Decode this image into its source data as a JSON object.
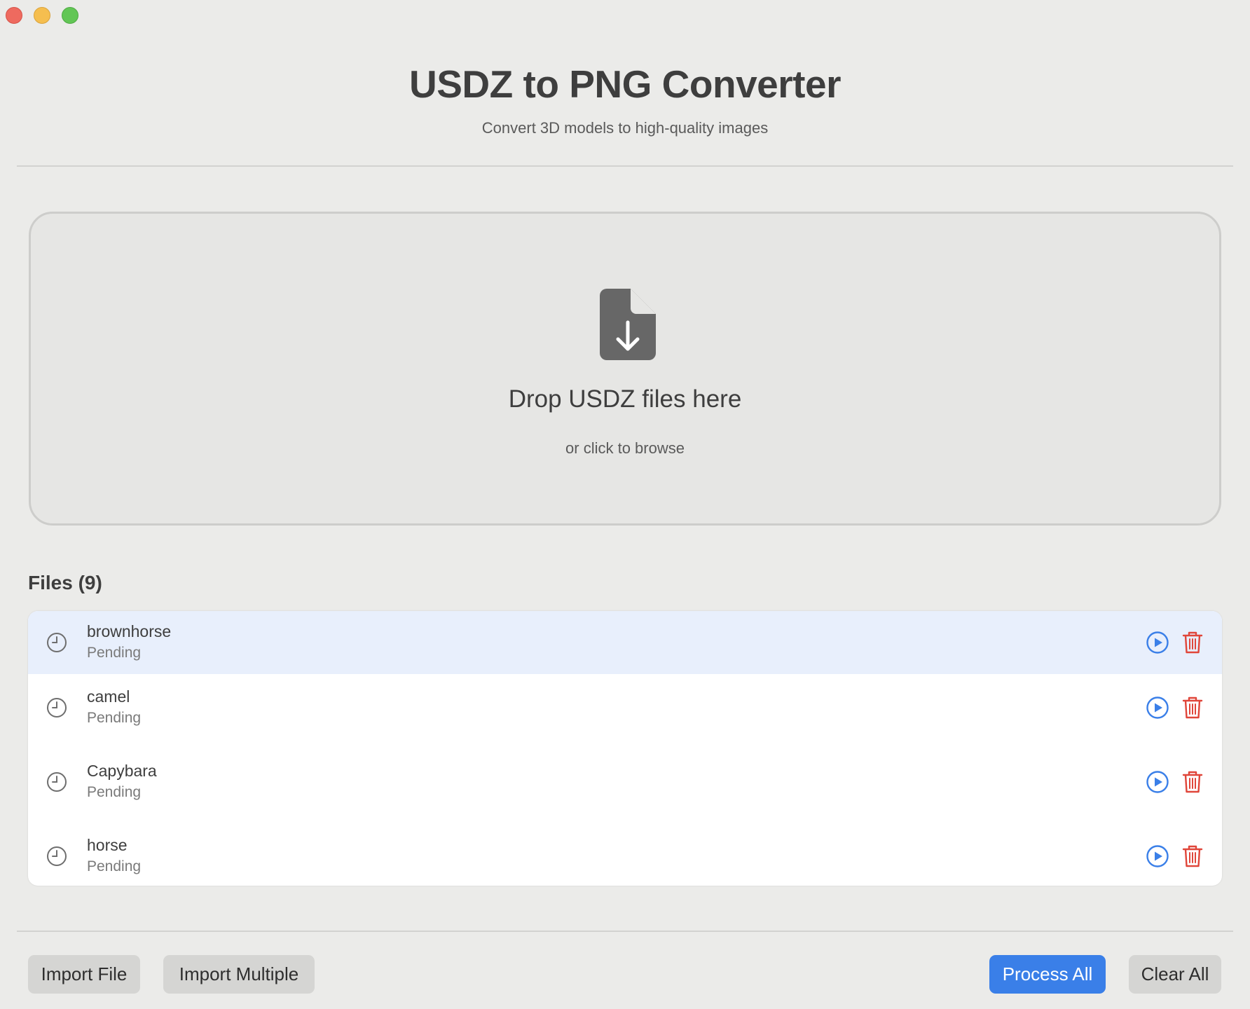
{
  "window": {
    "controls": [
      "close",
      "minimize",
      "maximize"
    ]
  },
  "header": {
    "title": "USDZ to PNG Converter",
    "subtitle": "Convert 3D models to high-quality images"
  },
  "dropzone": {
    "icon": "document-download-icon",
    "title": "Drop USDZ files here",
    "subtitle": "or click to browse"
  },
  "files": {
    "title": "Files (9)",
    "items": [
      {
        "name": "brownhorse",
        "status": "Pending",
        "selected": true
      },
      {
        "name": "camel",
        "status": "Pending",
        "selected": false
      },
      {
        "name": "Capybara",
        "status": "Pending",
        "selected": false
      },
      {
        "name": "horse",
        "status": "Pending",
        "selected": false
      }
    ]
  },
  "footer": {
    "import_file": "Import File",
    "import_multiple": "Import Multiple",
    "process_all": "Process All",
    "clear_all": "Clear All"
  },
  "colors": {
    "accent": "#3a7fe8",
    "delete": "#e0463a",
    "selected_row": "#e8effc"
  }
}
